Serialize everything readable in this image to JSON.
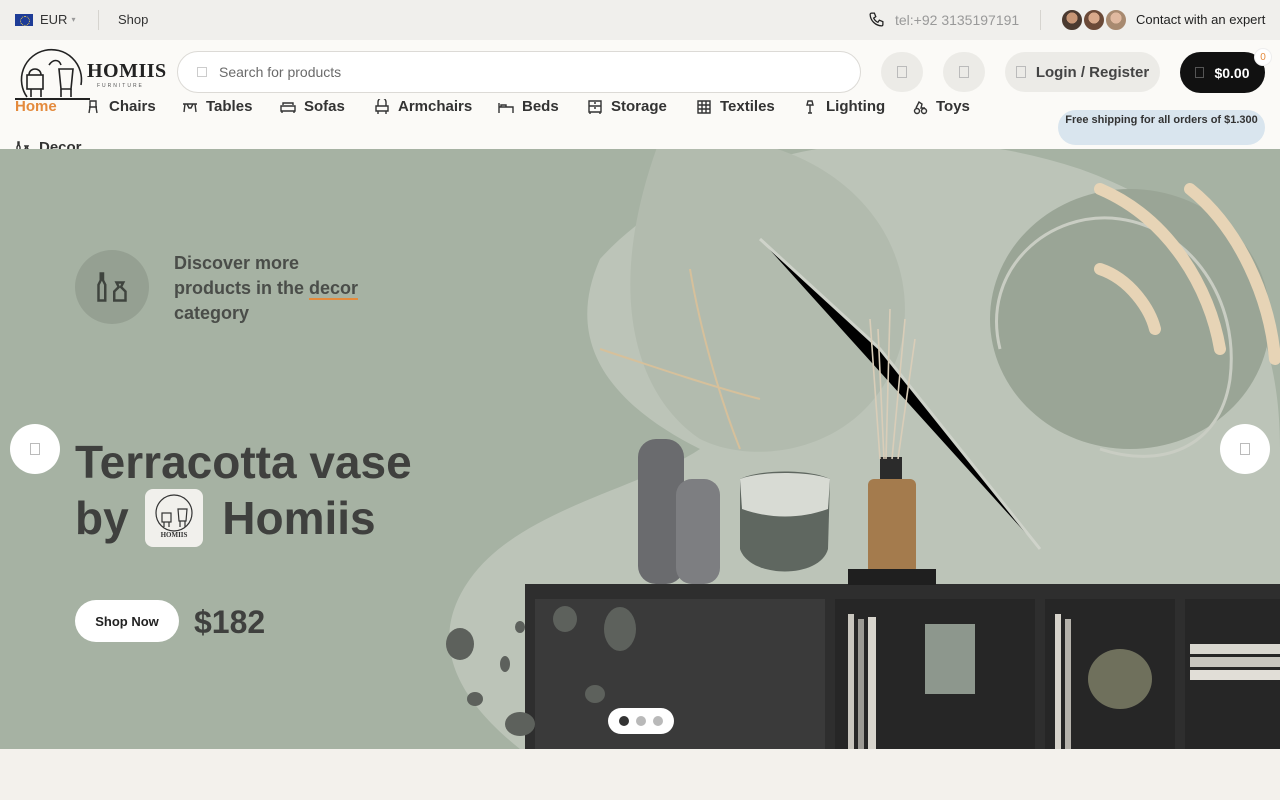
{
  "topbar": {
    "currency": "EUR",
    "shop": "Shop",
    "phone": "tel:+92 3135197191",
    "expert": "Contact with an expert"
  },
  "header": {
    "logo": {
      "name": "HOMIIS",
      "sub": "FURNITURE"
    },
    "search_placeholder": "Search for products",
    "login": "Login / Register",
    "cart_total": "$0.00",
    "cart_count": "0",
    "shipping": "Free shipping for all orders of $1.300"
  },
  "nav": [
    {
      "label": "Home",
      "icon": "none"
    },
    {
      "label": "Chairs",
      "icon": "chair-icon"
    },
    {
      "label": "Tables",
      "icon": "table-icon"
    },
    {
      "label": "Sofas",
      "icon": "sofa-icon"
    },
    {
      "label": "Armchairs",
      "icon": "armchair-icon"
    },
    {
      "label": "Beds",
      "icon": "bed-icon"
    },
    {
      "label": "Storage",
      "icon": "storage-icon"
    },
    {
      "label": "Textiles",
      "icon": "textiles-icon"
    },
    {
      "label": "Lighting",
      "icon": "lamp-icon"
    },
    {
      "label": "Toys",
      "icon": "toy-icon"
    },
    {
      "label": "Decor",
      "icon": "decor-icon"
    }
  ],
  "hero": {
    "category_line1": "Discover more",
    "category_line2_pre": "products in the",
    "category_highlight": "decor",
    "category_line3": "category",
    "title_line1": "Terracotta vase",
    "title_by": "by",
    "title_brand": "Homiis",
    "cta": "Shop Now",
    "price": "$182",
    "slide_count": 3,
    "active_slide": 1
  },
  "colors": {
    "accent": "#e48a3c",
    "hero_bg": "#a5b1a2",
    "cart_bg": "#111111",
    "ship_badge": "#d9e5ee"
  }
}
